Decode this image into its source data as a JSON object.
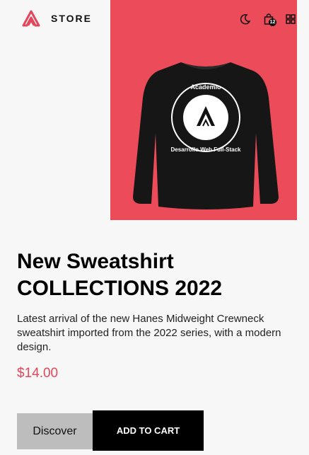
{
  "header": {
    "brand": "STORE",
    "cart_count": "12",
    "icons": [
      "logo-icon",
      "moon-icon",
      "shopping-bag-icon",
      "grid-icon"
    ]
  },
  "hero": {
    "background_color": "#ec4b5a",
    "product_image": "black-sweatshirt",
    "print_top_text": "Academlo",
    "print_bottom_text": "Desarrollo Web Full-Stack"
  },
  "product": {
    "title_line1": "New Sweatshirt",
    "title_line2": "COLLECTIONS 2022",
    "description": "Latest arrival of the new Hanes Midweight Crewneck sweatshirt imported from the 2022 series, with a modern design.",
    "price": "$14.00",
    "price_color": "#e2475a"
  },
  "actions": {
    "discover_label": "Discover",
    "add_to_cart_label": "ADD TO CART"
  }
}
